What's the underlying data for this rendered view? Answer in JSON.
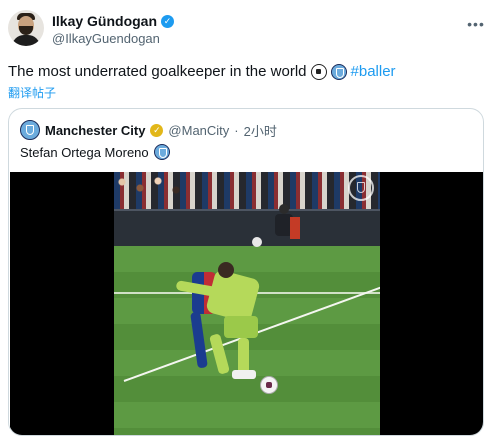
{
  "post": {
    "author": {
      "display_name": "Ilkay Gündogan",
      "handle": "@IlkayGuendogan",
      "verified": true,
      "avatar_icon": "user-avatar"
    },
    "more_icon": "more-icon",
    "text": "The most underrated goalkeeper in the world",
    "emojis": [
      "soccer-ball-icon",
      "man-city-crest-icon"
    ],
    "hashtag": "#baller",
    "translate_label": "翻译帖子"
  },
  "quoted_post": {
    "author": {
      "display_name": "Manchester City",
      "handle": "@ManCity",
      "verified": true,
      "badge_color": "#e2b719"
    },
    "separator": "·",
    "time": "2小时",
    "text": "Stefan Ortega Moreno",
    "emojis": [
      "man-city-crest-icon"
    ],
    "media": {
      "type": "video",
      "watermark": "man-city-crest-icon"
    }
  },
  "colors": {
    "link": "#1d9bf0",
    "secondary_text": "#536471",
    "border": "#cfd9de",
    "verified_blue": "#1d9bf0",
    "verified_gold": "#e2b719"
  }
}
